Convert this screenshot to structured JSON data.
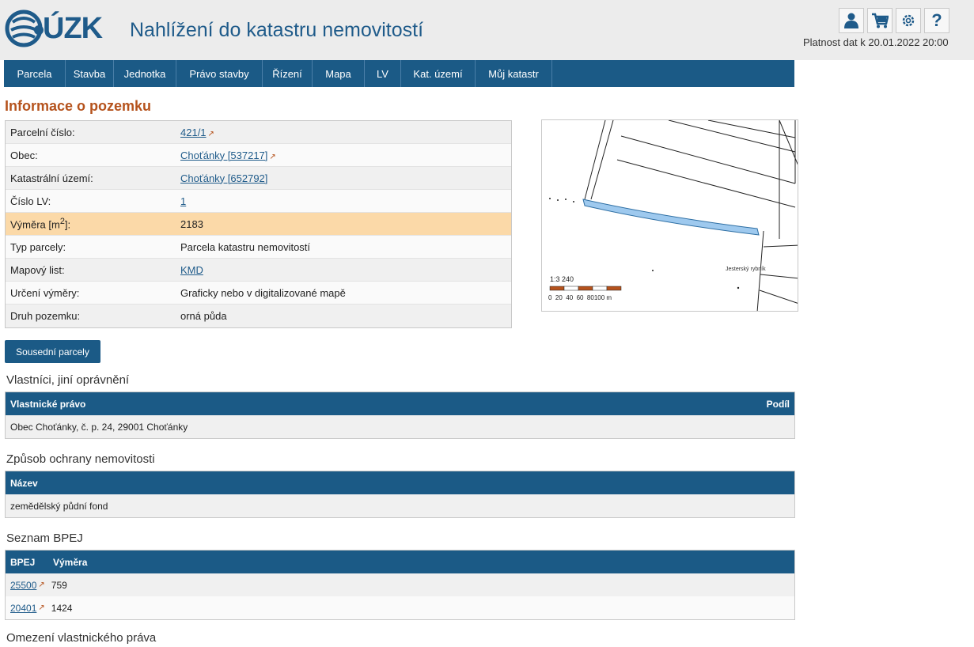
{
  "header": {
    "logo_text": "ÚZK",
    "app_title": "Nahlížení do katastru nemovitostí",
    "validity": "Platnost dat k 20.01.2022 20:00",
    "icons": [
      "user-icon",
      "cart-icon",
      "gear-icon",
      "help-icon"
    ],
    "help_glyph": "?"
  },
  "nav": {
    "items": [
      {
        "label": "Parcela",
        "w": 78
      },
      {
        "label": "Stavba",
        "w": 61
      },
      {
        "label": "Jednotka",
        "w": 79
      },
      {
        "label": "Právo stavby",
        "w": 109
      },
      {
        "label": "Řízení",
        "w": 63
      },
      {
        "label": "Mapa",
        "w": 66
      },
      {
        "label": "LV",
        "w": 46
      },
      {
        "label": "Kat. území",
        "w": 94
      },
      {
        "label": "Můj katastr",
        "w": 97
      }
    ]
  },
  "main": {
    "title": "Informace o pozemku",
    "rows": [
      {
        "label": "Parcelní číslo:",
        "value": "421/1"
      },
      {
        "label": "Obec:",
        "value": "Choťánky [537217]"
      },
      {
        "label": "Katastrální území:",
        "value": "Choťánky [652792]"
      },
      {
        "label": "Číslo LV:",
        "value": "1"
      },
      {
        "label": "Výměra [m",
        "label_sup": "2",
        "label_end": "]:",
        "value": "2183"
      },
      {
        "label": "Typ parcely:",
        "value": "Parcela katastru nemovitostí"
      },
      {
        "label": "Mapový list:",
        "value": "KMD"
      },
      {
        "label": "Určení výměry:",
        "value": "Graficky nebo v digitalizované mapě"
      },
      {
        "label": "Druh pozemku:",
        "value": "orná půda"
      }
    ],
    "neighbor_button": "Sousední parcely"
  },
  "map": {
    "scale_label": "1:3 240",
    "scale_ticks": "0  20  40  60  80100 m",
    "place_label": "Jesterský rybník",
    "highlight_color": "#9ec9ee"
  },
  "owners": {
    "title": "Vlastníci, jiní oprávnění",
    "col1": "Vlastnické právo",
    "col2": "Podíl",
    "row": "Obec Choťánky, č. p. 24, 29001 Choťánky"
  },
  "protection": {
    "title": "Způsob ochrany nemovitosti",
    "col": "Název",
    "row": "zemědělský půdní fond"
  },
  "bpej": {
    "title": "Seznam BPEJ",
    "col1": "BPEJ",
    "col2": "Výměra",
    "rows": [
      {
        "code": "25500",
        "area": "759"
      },
      {
        "code": "20401",
        "area": "1424"
      }
    ]
  },
  "restrictions": {
    "title": "Omezení vlastnického práva"
  },
  "colors": {
    "brand_blue": "#1b5a86",
    "title_orange": "#b5521c",
    "highlight_row": "#fbd9a8"
  }
}
